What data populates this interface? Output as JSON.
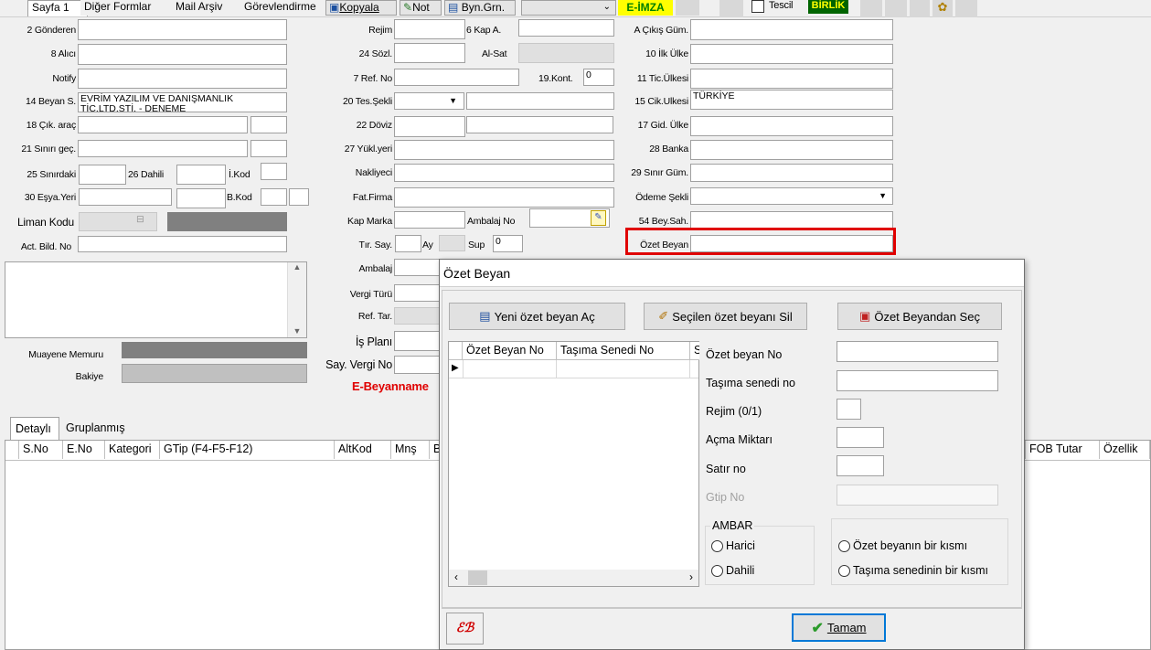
{
  "tabs": [
    "Sayfa 1",
    "Diğer Formlar",
    "Mail Arşiv",
    "Görevlendirme"
  ],
  "toolbar": {
    "kopyala": "Kopyala",
    "not": "Not",
    "byn_grn": "Byn.Grn.",
    "eimza": "E-İMZA",
    "tescil": "Tescil",
    "birlik": "BİRLİK"
  },
  "left": {
    "gonderen": "2 Gönderen",
    "alici": "8 Alıcı",
    "notify": "Notify",
    "beyan_s": "14 Beyan S.",
    "beyan_s_value": "EVRİM YAZILIM VE DANIŞMANLIK\nTİC.LTD.ŞTİ. - DENEME",
    "cik_arac": "18 Çık. araç",
    "sinir_gec": "21 Sınırı geç.",
    "sinirdaki": "25 Sınırdaki",
    "dahili": "26 Dahili",
    "ikod": "İ.Kod",
    "esya_yeri": "30 Eşya.Yeri",
    "bkod": "B.Kod",
    "liman_kodu": "Liman Kodu",
    "act_bild_no": "Act. Bild. No",
    "muayene_memuru": "Muayene Memuru",
    "bakiye": "Bakiye"
  },
  "mid": {
    "rejim": "Rejim",
    "kap_a": "6 Kap A.",
    "sozl": "24 Sözl.",
    "al_sat": "Al-Sat",
    "ref_no": "7 Ref. No",
    "kont": "19.Kont.",
    "kont_value": "0",
    "tes_sekli": "20 Tes.Şekli",
    "doviz": "22 Döviz",
    "yukl_yeri": "27 Yükl.yeri",
    "nakliyeci": "Nakliyeci",
    "fat_firma": "Fat.Firma",
    "kap_marka": "Kap Marka",
    "ambalaj_no": "Ambalaj No",
    "tir_say": "Tır. Say.",
    "ay": "Ay",
    "sup": "Sup",
    "sup_value": "0",
    "ambalaj": "Ambalaj",
    "vergi_turu": "Vergi Türü",
    "ref_tar": "Ref. Tar.",
    "is_plani": "İş Planı",
    "say_vergi_no": "Say. Vergi No",
    "e_beyanname": "E-Beyanname"
  },
  "right": {
    "cikis_gum": "A Çıkış Güm.",
    "ilk_ulke": "10 İlk Ülke",
    "tic_ulkesi": "11 Tic.Ülkesi",
    "cik_ulkesi": "15 Cik.Ulkesi",
    "cik_ulkesi_value": "TÜRKİYE",
    "gid_ulke": "17 Gid. Ülke",
    "banka": "28 Banka",
    "sinir_gum": "29 Sınır Güm.",
    "odeme_sekli": "Ödeme Şekli",
    "bey_sah": "54 Bey.Sah.",
    "ozet_beyan": "Özet Beyan"
  },
  "bottom": {
    "tabs": [
      "Detaylı",
      "Gruplanmış"
    ],
    "columns_left": [
      "S.No",
      "E.No",
      "Kategori",
      "GTip (F4-F5-F12)",
      "AltKod",
      "Mnş",
      "B"
    ],
    "columns_right": [
      "FOB Tutar",
      "Özellik"
    ]
  },
  "dialog": {
    "title": "Özet Beyan",
    "btn_new": "Yeni özet beyan Aç",
    "btn_delete": "Seçilen özet beyanı Sil",
    "btn_select": "Özet Beyandan Seç",
    "grid_columns": [
      "Özet Beyan No",
      "Taşıma Senedi No",
      "S"
    ],
    "ozet_beyan_no": "Özet beyan No",
    "tasima_senedi_no": "Taşıma senedi no",
    "rejim": "Rejim  (0/1)",
    "acma_miktari": "Açma Miktarı",
    "satir_no": "Satır no",
    "gtip_no": "Gtip No",
    "ambar_title": "AMBAR",
    "harici": "Harici",
    "dahili": "Dahili",
    "ozet_bir_kismi": "Özet beyanın bir kısmı",
    "tasima_bir_kismi": "Taşıma senedinin bir kısmı",
    "ok": "Tamam"
  },
  "colors": {
    "highlight": "#e00000",
    "eimza_bg": "#ffff00",
    "eimza_text": "#008000",
    "birlik_bg": "#006400",
    "birlik_text": "#ffff00",
    "e_beyanname": "#e00000"
  }
}
